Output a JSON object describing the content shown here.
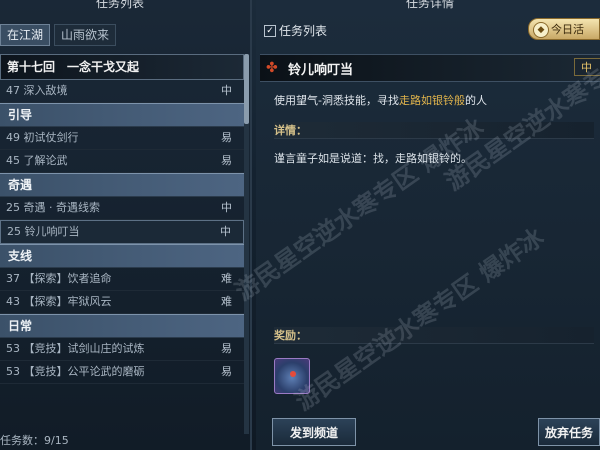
{
  "left_panel": {
    "title": "任务列表",
    "tabs": [
      {
        "label": "在江湖",
        "active": true
      },
      {
        "label": "山雨欲来",
        "active": false
      }
    ],
    "chapter": "第十七回　一念干戈又起",
    "items": [
      {
        "kind": "row",
        "text": "47  深入敌境",
        "diff": "中"
      },
      {
        "kind": "cat",
        "text": "引导"
      },
      {
        "kind": "row",
        "text": "49  初试仗剑行",
        "diff": "易"
      },
      {
        "kind": "row",
        "text": "45  了解论武",
        "diff": "易"
      },
      {
        "kind": "cat",
        "text": "奇遇"
      },
      {
        "kind": "row",
        "text": "25  奇遇 · 奇遇线索",
        "diff": "中"
      },
      {
        "kind": "row",
        "text": "25  铃儿响叮当",
        "diff": "中",
        "selected": true
      },
      {
        "kind": "cat",
        "text": "支线"
      },
      {
        "kind": "row",
        "text": "37 【探索】饮者追命",
        "diff": "难"
      },
      {
        "kind": "row",
        "text": "43 【探索】牢狱风云",
        "diff": "难"
      },
      {
        "kind": "cat",
        "text": "日常"
      },
      {
        "kind": "row",
        "text": "53 【竞技】试剑山庄的试炼",
        "diff": "易"
      },
      {
        "kind": "row",
        "text": "53 【竞技】公平论武的磨砺",
        "diff": "易"
      }
    ],
    "count_label": "任务数：9/15"
  },
  "right_panel": {
    "title": "任务详情",
    "checkbox_label": "任务列表",
    "checkbox_checked": true,
    "daily_button": "今日活",
    "quest_name": "铃儿响叮当",
    "quest_tag": "中",
    "objective_prefix": "使用望气-洞悉技能，寻找",
    "objective_highlight": "走路如银铃般",
    "objective_suffix": "的人",
    "details_header": "详情：",
    "details_text": "谨言童子如是说道：找，走路如银铃的。",
    "rewards_header": "奖励：",
    "reward_icon": "gourd-item-icon",
    "buttons": {
      "goto": "发到频道",
      "abandon": "放弃任务"
    }
  },
  "watermarks": [
    "游民星空逆水寒专区 爆炸冰",
    "游民星空逆水寒专区 爆炸冰",
    "游民星空逆水寒专区 爆炸冰"
  ],
  "colors": {
    "highlight": "#e1b44c",
    "category_bg": "#4d6582",
    "accent_red": "#d24a28"
  }
}
